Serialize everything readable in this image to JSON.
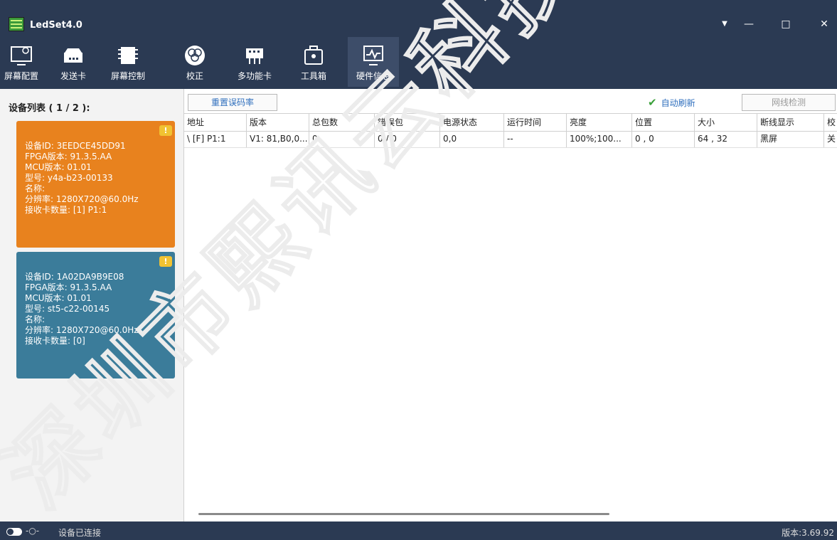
{
  "app": {
    "title": "LedSet4.0"
  },
  "window": {
    "minimize": "—",
    "maximize": "□",
    "close": "✕",
    "menu": "▼"
  },
  "toolbar": {
    "items": [
      {
        "label": "屏幕配置",
        "icon": "monitor-settings-icon"
      },
      {
        "label": "发送卡",
        "icon": "sender-card-icon"
      },
      {
        "label": "屏幕控制",
        "icon": "chip-icon"
      },
      {
        "label": "校正",
        "icon": "color-wheel-icon"
      },
      {
        "label": "多功能卡",
        "icon": "multifunction-card-icon"
      },
      {
        "label": "工具箱",
        "icon": "toolbox-icon"
      },
      {
        "label": "硬件信息",
        "icon": "hardware-monitor-icon",
        "active": true
      }
    ]
  },
  "sidebar": {
    "title": "设备列表 ( 1 / 2 ):",
    "devices": [
      {
        "color": "#e8821e",
        "warning": "!",
        "lines": [
          "设备ID:  3EEDCE45DD91",
          "FPGA版本: 91.3.5.AA",
          "MCU版本: 01.01",
          "型号:  y4a-b23-00133",
          "名称:",
          "分辨率:  1280X720@60.0Hz",
          "接收卡数量:  [1] P1:1"
        ]
      },
      {
        "color": "#3b7c9a",
        "warning": "!",
        "lines": [
          "设备ID:  1A02DA9B9E08",
          "FPGA版本: 91.3.5.AA",
          "MCU版本: 01.01",
          "型号:  st5-c22-00145",
          "名称:",
          "分辨率:  1280X720@60.0Hz",
          "接收卡数量:  [0]"
        ]
      }
    ]
  },
  "actions": {
    "reset_label": "重置误码率",
    "auto_refresh_label": "自动刷新",
    "auto_refresh_checked": true,
    "cable_check_label": "网线检测"
  },
  "table": {
    "columns": [
      "地址",
      "版本",
      "总包数",
      "错误包",
      "电源状态",
      "运行时间",
      "亮度",
      "位置",
      "大小",
      "断线显示",
      "校"
    ],
    "rows": [
      [
        "\\ [F] P1:1",
        "V1: 81,B0,0...",
        "0",
        "0 / 0",
        "0,0",
        "--",
        "100%;100...",
        "0 , 0",
        "64 , 32",
        "黑屏",
        "关"
      ]
    ]
  },
  "status": {
    "connection": "设备已连接",
    "version": "版本:3.69.92"
  },
  "watermark": {
    "text": "深圳市熙讯云科技有"
  }
}
